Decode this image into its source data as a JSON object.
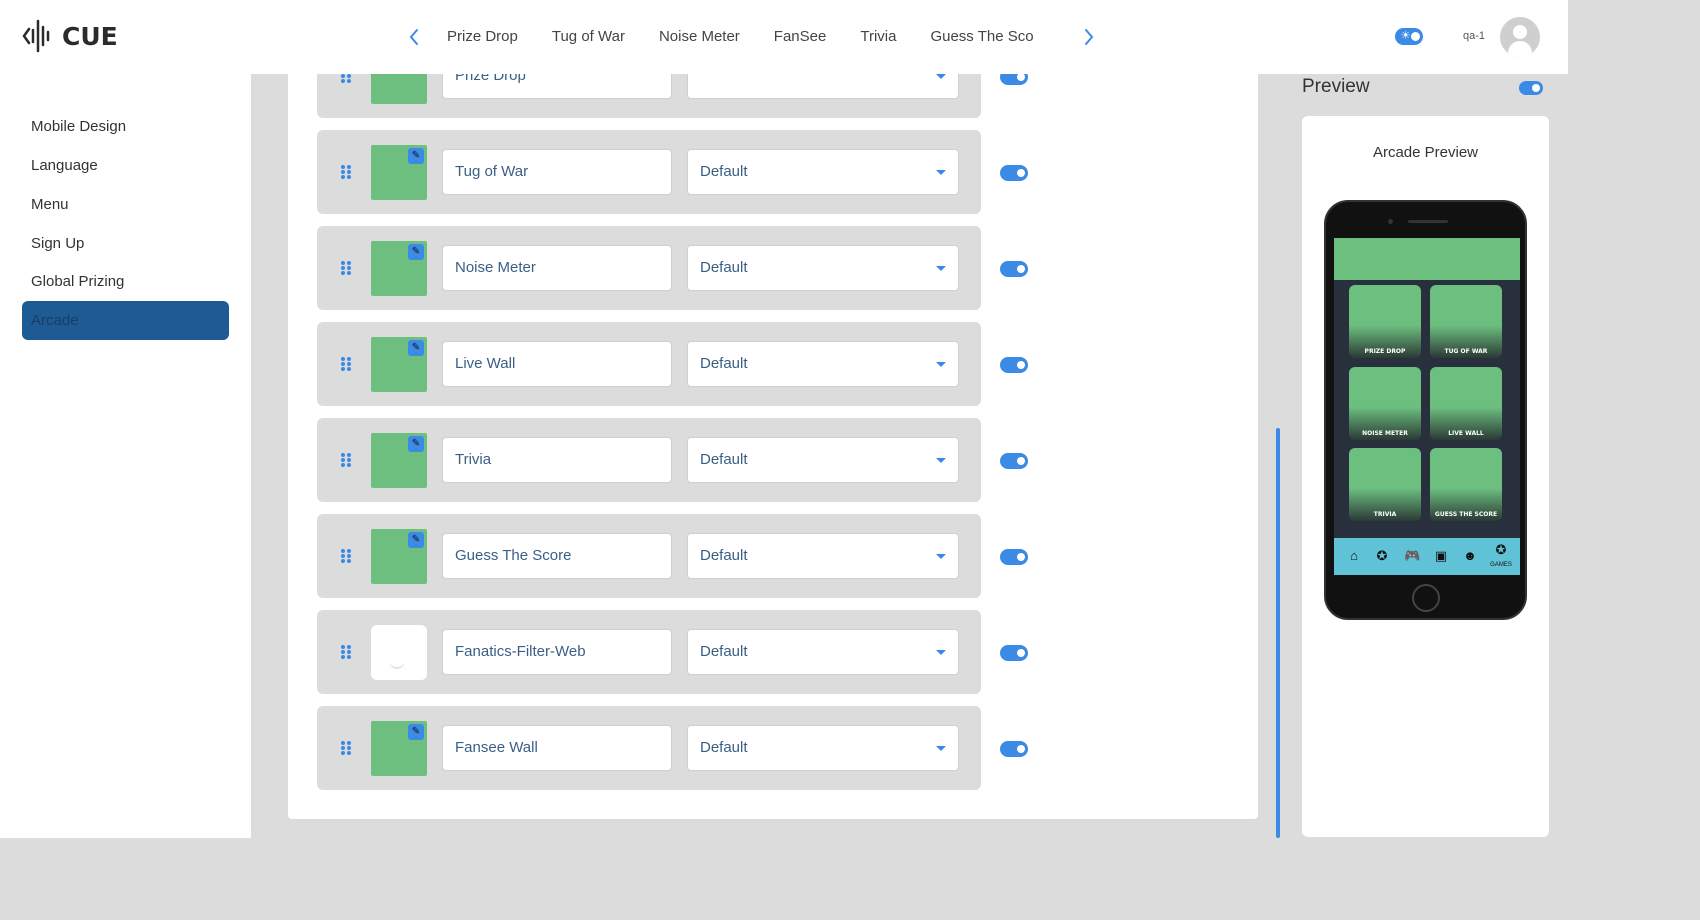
{
  "header": {
    "logo_text": "CUE",
    "nav_tabs": [
      "Prize Drop",
      "Tug of War",
      "Noise Meter",
      "FanSee",
      "Trivia",
      "Guess The Sco"
    ],
    "prev_arrow": "‹",
    "next_arrow": "›",
    "user_name": "qa-1",
    "theme_icon": "sun-icon"
  },
  "sidebar": {
    "items": [
      {
        "label": "Mobile Design",
        "active": false
      },
      {
        "label": "Language",
        "active": false
      },
      {
        "label": "Menu",
        "active": false
      },
      {
        "label": "Sign Up",
        "active": false
      },
      {
        "label": "Global Prizing",
        "active": false
      },
      {
        "label": "Arcade",
        "active": true
      }
    ]
  },
  "games": [
    {
      "name": "Prize Drop",
      "theme": "",
      "enabled": true,
      "thumbnail": "green"
    },
    {
      "name": "Tug of War",
      "theme": "Default",
      "enabled": true,
      "thumbnail": "green"
    },
    {
      "name": "Noise Meter",
      "theme": "Default",
      "enabled": true,
      "thumbnail": "green"
    },
    {
      "name": "Live Wall",
      "theme": "Default",
      "enabled": true,
      "thumbnail": "green"
    },
    {
      "name": "Trivia",
      "theme": "Default",
      "enabled": true,
      "thumbnail": "green"
    },
    {
      "name": "Guess The Score",
      "theme": "Default",
      "enabled": true,
      "thumbnail": "green"
    },
    {
      "name": "Fanatics-Filter-Web",
      "theme": "Default",
      "enabled": true,
      "thumbnail": "white"
    },
    {
      "name": "Fansee Wall",
      "theme": "Default",
      "enabled": true,
      "thumbnail": "green"
    }
  ],
  "preview": {
    "title": "Preview",
    "enabled": true,
    "card_label": "Arcade Preview",
    "tiles": [
      "PRIZE DROP",
      "TUG OF WAR",
      "NOISE METER",
      "LIVE WALL",
      "TRIVIA",
      "GUESS THE SCORE"
    ],
    "tab_bar": {
      "icons": [
        "home-icon",
        "star-badge-icon",
        "gamepad-icon",
        "trophy-card-icon",
        "fan-icon"
      ],
      "active_label": "GAMES"
    }
  },
  "colors": {
    "accent": "#3b8be6",
    "active_nav": "#1e5b94",
    "thumbnail_green": "#6dbf80",
    "panel_gray": "#dcdcdc",
    "phone_tabbar": "#5fc2d6"
  }
}
